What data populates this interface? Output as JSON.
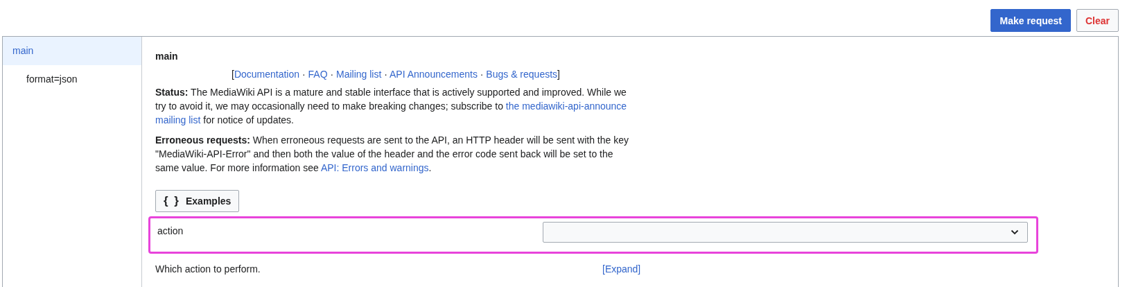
{
  "toolbar": {
    "buttons": [
      {
        "label": "Make request",
        "kind": "primary"
      },
      {
        "label": "Clear",
        "kind": "destructive"
      }
    ]
  },
  "sidebar": {
    "items": [
      {
        "label": "main",
        "selected": true,
        "children": [
          {
            "label": "format=json",
            "selected": false
          }
        ]
      }
    ]
  },
  "module": {
    "title": "main",
    "links": [
      {
        "kind": "punct",
        "text": "["
      },
      {
        "kind": "link",
        "text": "Documentation"
      },
      {
        "kind": "punct",
        "text": " · "
      },
      {
        "kind": "link",
        "text": "FAQ"
      },
      {
        "kind": "punct",
        "text": " · "
      },
      {
        "kind": "link",
        "text": "Mailing list"
      },
      {
        "kind": "punct",
        "text": " · "
      },
      {
        "kind": "link",
        "text": "API Announcements"
      },
      {
        "kind": "punct",
        "text": " · "
      },
      {
        "kind": "link",
        "text": "Bugs & requests"
      },
      {
        "kind": "punct",
        "text": "]"
      }
    ],
    "paragraphs": [
      [
        {
          "kind": "text",
          "text": "**Status:** The MediaWiki API is a mature and stable interface that is actively supported and improved. While we try to avoid it, we may occasionally need to make breaking changes; subscribe to "
        },
        {
          "kind": "link",
          "text": "the mediawiki-api-announce"
        },
        {
          "kind": "link",
          "text": "mailing list"
        },
        {
          "kind": "text",
          "text": " for notice of updates."
        }
      ],
      [
        {
          "kind": "text",
          "text": "**Erroneous requests:** When erroneous requests are sent to the API, an HTTP header will be sent with the key \"MediaWiki-API-Error\" and then both the value of the header and the error code sent back will be set to the same value. For more information see "
        },
        {
          "kind": "link",
          "text": "API: Errors and warnings"
        },
        {
          "kind": "text",
          "text": "."
        }
      ]
    ],
    "examples_button": {
      "label": "Examples",
      "icon": "{ }"
    },
    "fields": [
      {
        "label": "action",
        "highlighted": true,
        "description": "Which action to perform.",
        "expand": "[Expand]"
      }
    ]
  }
}
